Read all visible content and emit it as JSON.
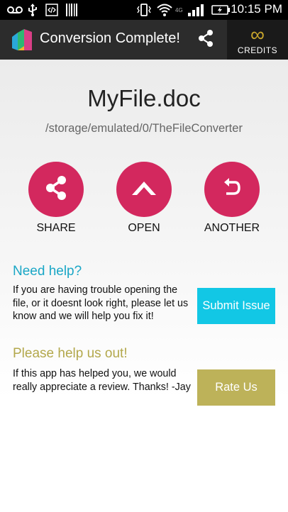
{
  "status_bar": {
    "time": "10:15",
    "meridiem": "PM",
    "network_label": "4G",
    "icons": [
      "voicemail-icon",
      "usb-icon",
      "code-icon",
      "barcode-icon",
      "vibrate-icon",
      "wifi-icon",
      "signal-icon",
      "battery-charging-icon"
    ]
  },
  "action_bar": {
    "title": "Conversion Complete!",
    "share_icon": "share-icon",
    "credits_symbol": "∞",
    "credits_label": "CREDITS"
  },
  "file": {
    "name": "MyFile.doc",
    "path": "/storage/emulated/0/TheFileConverter"
  },
  "actions": [
    {
      "label": "SHARE",
      "icon": "share-icon"
    },
    {
      "label": "OPEN",
      "icon": "chevron-up-icon"
    },
    {
      "label": "ANOTHER",
      "icon": "undo-icon"
    }
  ],
  "help": {
    "title": "Need help?",
    "body": "If you are having trouble opening the file, or it doesnt look right, please let us know and we will help you fix it!",
    "button": "Submit Issue"
  },
  "review": {
    "title": "Please help us out!",
    "body": "If this app has helped you, we would really appreciate a review. Thanks! -Jay",
    "button": "Rate Us"
  },
  "colors": {
    "accent_pink": "#d3285e",
    "help_cyan": "#1aa7c6",
    "submit_button": "#12c7e5",
    "review_olive": "#b3a84c",
    "rate_button": "#bdb259",
    "credits_gold": "#c9a62c"
  }
}
